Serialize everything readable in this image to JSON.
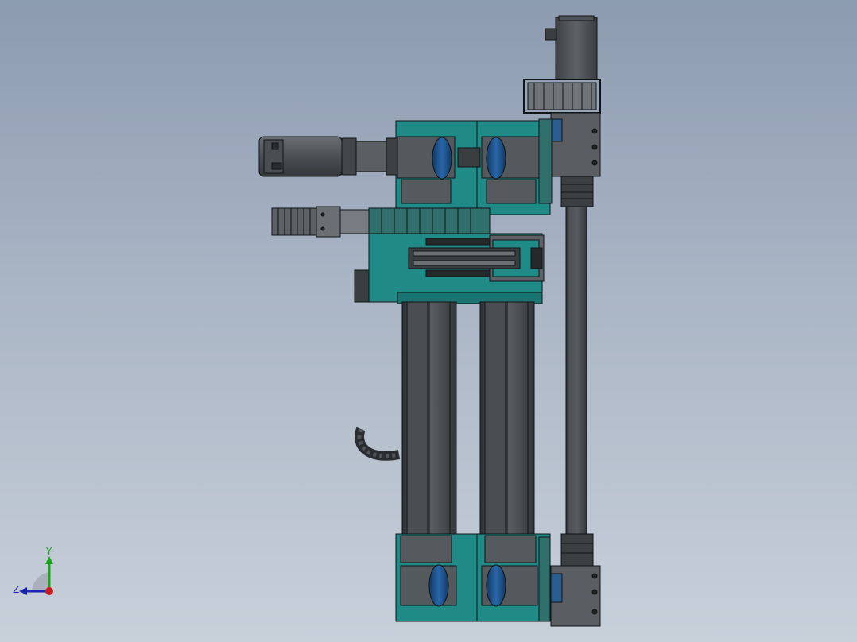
{
  "viewport": {
    "background_top": "#8c9bb0",
    "background_bottom": "#c8d0da"
  },
  "model": {
    "name": "cartesian-gantry-assembly",
    "colors": {
      "teal_plate": "#1f8a86",
      "teal_dark": "#0e5f5c",
      "housing_gray": "#4f5357",
      "housing_light": "#6b7075",
      "rail_dark": "#2e3235",
      "blue_window": "#1d4f86",
      "outline": "#111416"
    }
  },
  "triad": {
    "y_label": "Y",
    "z_label": "Z",
    "y_color": "#1aa51a",
    "z_color": "#1a24b0",
    "origin_color": "#c81c1c"
  }
}
